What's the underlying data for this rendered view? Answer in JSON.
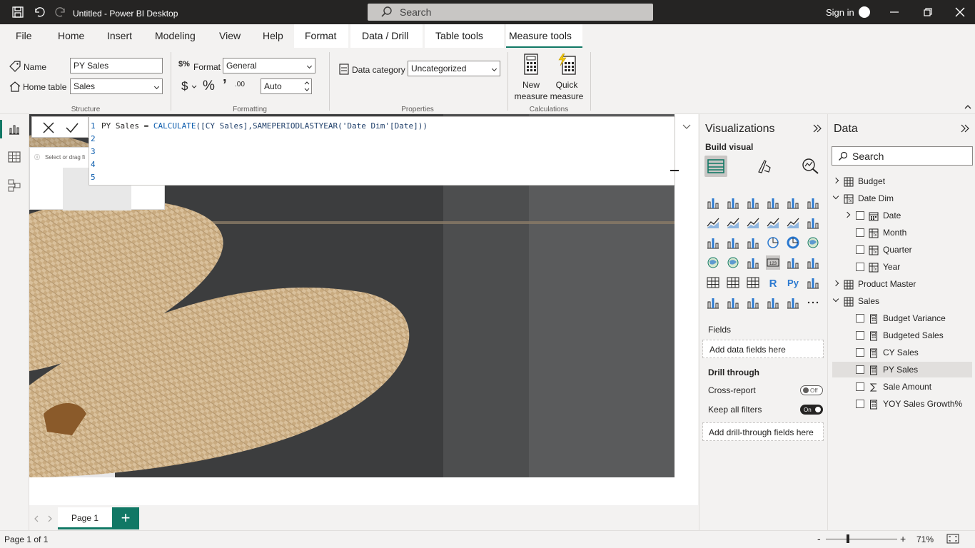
{
  "titlebar": {
    "title": "Untitled - Power BI Desktop",
    "search_placeholder": "Search",
    "signin": "Sign in",
    "colors": {
      "bg": "#252423",
      "search_bg": "#c8c6c4"
    }
  },
  "ribbon_tabs": [
    "File",
    "Home",
    "Insert",
    "Modeling",
    "View",
    "Help",
    "Format",
    "Data / Drill",
    "Table tools",
    "Measure tools"
  ],
  "ribbon": {
    "structure": {
      "name_label": "Name",
      "name_value": "PY Sales",
      "home_table_label": "Home table",
      "home_table_value": "Sales",
      "group": "Structure"
    },
    "formatting": {
      "format_label": "Format",
      "format_value": "General",
      "currency": "$",
      "percent": "%",
      "comma": "’",
      "decimals": ".00",
      "auto_value": "Auto",
      "group": "Formatting"
    },
    "properties": {
      "data_category_label": "Data category",
      "data_category_value": "Uncategorized",
      "group": "Properties"
    },
    "calculations": {
      "new_measure": [
        "New",
        "measure"
      ],
      "quick_measure": [
        "Quick",
        "measure"
      ],
      "group": "Calculations"
    }
  },
  "formula": {
    "lines": [
      "1",
      "2",
      "3",
      "4",
      "5"
    ],
    "name_part": "PY Sales = ",
    "func_part": "CALCULATE",
    "rest_part": "([CY Sales],SAMEPERIODLASTYEAR('Date Dim'[Date]))"
  },
  "canvas": {
    "small_visual_hint": "Select or drag fi"
  },
  "visualizations": {
    "title": "Visualizations",
    "build_visual": "Build visual",
    "fields_label": "Fields",
    "add_data_fields": "Add data fields here",
    "drill_through": "Drill through",
    "cross_report": "Cross-report",
    "cross_report_toggle": "Off",
    "keep_all_filters": "Keep all filters",
    "keep_all_filters_toggle": "On",
    "add_drill_fields": "Add drill-through fields here"
  },
  "data": {
    "title": "Data",
    "search_placeholder": "Search",
    "tables": [
      {
        "name": "Budget",
        "expanded": false,
        "fields": []
      },
      {
        "name": "Date Dim",
        "expanded": true,
        "fields": [
          {
            "name": "Date",
            "icon": "calendar-icon",
            "expandable": true
          },
          {
            "name": "Month",
            "icon": "calculated-table-icon"
          },
          {
            "name": "Quarter",
            "icon": "calculated-table-icon"
          },
          {
            "name": "Year",
            "icon": "calculated-table-icon"
          }
        ]
      },
      {
        "name": "Product Master",
        "expanded": false,
        "fields": []
      },
      {
        "name": "Sales",
        "expanded": true,
        "fields": [
          {
            "name": "Budget Variance",
            "icon": "calculator-icon"
          },
          {
            "name": "Budgeted Sales",
            "icon": "calculator-icon"
          },
          {
            "name": "CY Sales",
            "icon": "calculator-icon"
          },
          {
            "name": "PY Sales",
            "icon": "calculator-icon",
            "selected": true
          },
          {
            "name": "Sale Amount",
            "icon": "sigma-icon"
          },
          {
            "name": "YOY Sales Growth%",
            "icon": "calculator-icon"
          }
        ]
      }
    ]
  },
  "pages": {
    "tab": "Page 1",
    "add": "+"
  },
  "status": {
    "page": "Page 1 of 1",
    "zoom": "71%",
    "zoom_minus": "-",
    "zoom_plus": "+"
  },
  "colors": {
    "accent": "#117865"
  }
}
